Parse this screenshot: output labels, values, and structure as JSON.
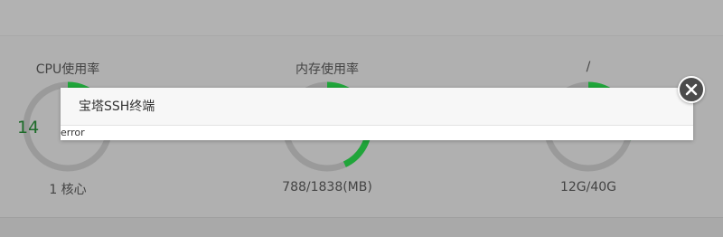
{
  "gauges": [
    {
      "title": "CPU使用率",
      "value": "14",
      "sub": "1 核心",
      "fraction": 0.14
    },
    {
      "title": "内存使用率",
      "value": "",
      "sub": "788/1838(MB)",
      "fraction": 0.43
    },
    {
      "title": "/",
      "value": "",
      "sub": "12G/40G",
      "fraction": 0.3
    }
  ],
  "dialog": {
    "title": "宝塔SSH终端",
    "body": "error",
    "close_icon": "close-icon"
  },
  "colors": {
    "accent": "#20a53a",
    "track": "#9a9a9a",
    "value_text": "#1e6b2a"
  }
}
